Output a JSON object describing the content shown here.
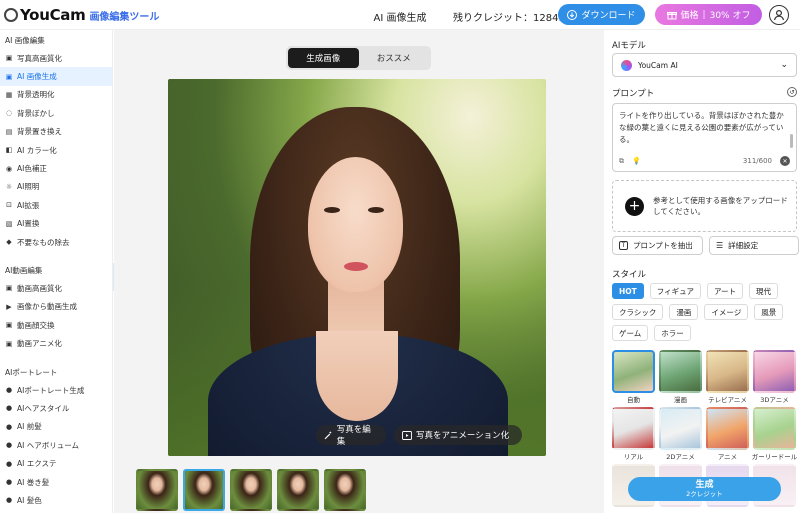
{
  "header": {
    "logo": "YouCam",
    "logo_sub": "画像編集ツール",
    "title": "AI 画像生成",
    "credits": "残りクレジット：12849",
    "download_label": "ダウンロード",
    "price_label": "価格",
    "price_discount": "30% オフ"
  },
  "sidebar": {
    "sections": [
      {
        "title": "AI 画像編集",
        "items": [
          {
            "label": "写真高画質化",
            "icon": "image-enhance-icon",
            "glyph": "▣"
          },
          {
            "label": "AI 画像生成",
            "icon": "ai-image-icon",
            "glyph": "▣",
            "active": true
          },
          {
            "label": "背景透明化",
            "icon": "transparent-bg-icon",
            "glyph": "▦"
          },
          {
            "label": "背景ぼかし",
            "icon": "blur-icon",
            "glyph": "◌"
          },
          {
            "label": "背景置き換え",
            "icon": "replace-bg-icon",
            "glyph": "▤"
          },
          {
            "label": "AI カラー化",
            "icon": "colorize-icon",
            "glyph": "◧"
          },
          {
            "label": "AI色補正",
            "icon": "color-correct-icon",
            "glyph": "◉"
          },
          {
            "label": "AI照明",
            "icon": "lighting-icon",
            "glyph": "☼"
          },
          {
            "label": "AI拡張",
            "icon": "expand-icon",
            "glyph": "⊡"
          },
          {
            "label": "AI置換",
            "icon": "replace-icon",
            "glyph": "▧"
          },
          {
            "label": "不要なもの除去",
            "icon": "eraser-icon",
            "glyph": "◆"
          }
        ]
      },
      {
        "title": "AI動画編集",
        "items": [
          {
            "label": "動画高画質化",
            "icon": "video-enhance-icon",
            "glyph": "▣"
          },
          {
            "label": "画像から動画生成",
            "icon": "image-to-video-icon",
            "glyph": "▶"
          },
          {
            "label": "動画顔交換",
            "icon": "face-swap-icon",
            "glyph": "▣"
          },
          {
            "label": "動画アニメ化",
            "icon": "video-anime-icon",
            "glyph": "▣"
          }
        ]
      },
      {
        "title": "AIポートレート",
        "items": [
          {
            "label": "AIポートレート生成",
            "icon": "portrait-icon",
            "glyph": "●"
          },
          {
            "label": "AIヘアスタイル",
            "icon": "hairstyle-icon",
            "glyph": "●"
          },
          {
            "label": "AI 前髪",
            "icon": "bangs-icon",
            "glyph": "●"
          },
          {
            "label": "AI ヘアボリューム",
            "icon": "hair-volume-icon",
            "glyph": "●"
          },
          {
            "label": "AI エクステ",
            "icon": "extension-icon",
            "glyph": "●"
          },
          {
            "label": "AI 巻き髪",
            "icon": "curl-icon",
            "glyph": "●"
          },
          {
            "label": "AI 髪色",
            "icon": "hair-color-icon",
            "glyph": "●"
          }
        ]
      }
    ]
  },
  "center": {
    "tabs": [
      {
        "label": "生成画像",
        "active": true
      },
      {
        "label": "おススメ",
        "active": false
      }
    ],
    "edit_photo_label": "写真を編集",
    "animate_photo_label": "写真をアニメーション化",
    "thumbnail_count": 5,
    "selected_thumbnail": 2
  },
  "right": {
    "model_label": "AIモデル",
    "model_value": "YouCam AI",
    "prompt_label": "プロンプト",
    "prompt_text": "ライトを作り出している。背景はぼかされた豊かな緑の葉と遠くに見える公園の要素が広がっている。",
    "prompt_count": "311/600",
    "upload_text": "参考として使用する画像をアップロードしてください。",
    "extract_label": "プロンプトを抽出",
    "detail_label": "詳細設定",
    "style_label": "スタイル",
    "style_chips": [
      {
        "label": "HOT",
        "active": true
      },
      {
        "label": "フィギュア"
      },
      {
        "label": "アート"
      },
      {
        "label": "現代"
      },
      {
        "label": "クラシック"
      },
      {
        "label": "漫画"
      },
      {
        "label": "イメージ"
      },
      {
        "label": "風景"
      },
      {
        "label": "ゲーム"
      },
      {
        "label": "ホラー"
      }
    ],
    "styles": [
      {
        "label": "自動",
        "active": true,
        "bg": "linear-gradient(160deg,#d9e6c3,#8fb27a 55%,#f2d2c0)"
      },
      {
        "label": "漫画",
        "bg": "linear-gradient(160deg,#bfe0c9,#6ea474 55%,#4a6d40)"
      },
      {
        "label": "テレビアニメ",
        "bg": "linear-gradient(160deg,#f1e3b6,#d8b788 55%,#9a6f4f)"
      },
      {
        "label": "3Dアニメ",
        "bg": "linear-gradient(160deg,#f7d6e6,#e59ab9 55%,#8e5fb2)"
      },
      {
        "label": "リアル",
        "bg": "linear-gradient(160deg,#f3f3f3,#e5e5e5 50%,#c63b3b)"
      },
      {
        "label": "2Dアニメ",
        "bg": "linear-gradient(160deg,#d7ecf5,#f2f2f2 55%,#a9c6dc)"
      },
      {
        "label": "アニメ",
        "bg": "linear-gradient(160deg,#cfe4f5,#f1a56a 55%,#d0605a)"
      },
      {
        "label": "ガーリードール",
        "bg": "linear-gradient(160deg,#d6efcf,#a7d28e 55%,#e9b49a)"
      },
      {
        "label": "",
        "bg": "linear-gradient(180deg,#e9e4dc,#f5f0ea)"
      },
      {
        "label": "",
        "bg": "linear-gradient(180deg,#efe0ea,#f7f0f4)"
      },
      {
        "label": "",
        "bg": "linear-gradient(180deg,#e6d8ee,#f4eef8)"
      },
      {
        "label": "",
        "bg": "linear-gradient(180deg,#f1e2ea,#f8f0f4)"
      }
    ],
    "generate_label": "生成",
    "generate_cost": "2クレジット"
  },
  "colors": {
    "accent": "#2f8ee6",
    "price_gradient_start": "#e978e0",
    "price_gradient_end": "#c25ee3",
    "active_sidebar_bg": "#e6f2ff",
    "active_sidebar_text": "#1a73e8"
  }
}
